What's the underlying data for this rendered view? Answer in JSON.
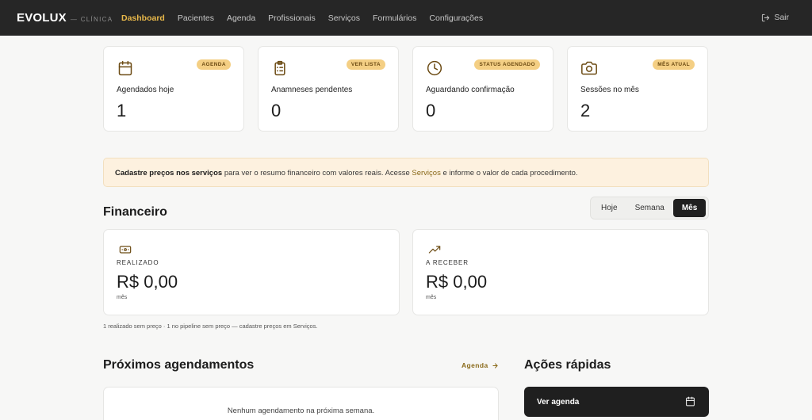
{
  "brand": {
    "name": "EVOLUX",
    "sub": "— CLÍNICA"
  },
  "nav": {
    "items": [
      {
        "label": "Dashboard"
      },
      {
        "label": "Pacientes"
      },
      {
        "label": "Agenda"
      },
      {
        "label": "Profissionais"
      },
      {
        "label": "Serviços"
      },
      {
        "label": "Formulários"
      },
      {
        "label": "Configurações"
      }
    ],
    "active": "Dashboard",
    "logout": "Sair"
  },
  "stats": [
    {
      "icon": "calendar-icon",
      "badge": "AGENDA",
      "label": "Agendados hoje",
      "value": "1"
    },
    {
      "icon": "clipboard-list-icon",
      "badge": "VER LISTA",
      "label": "Anamneses pendentes",
      "value": "0"
    },
    {
      "icon": "clock-icon",
      "badge": "STATUS AGENDADO",
      "label": "Aguardando confirmação",
      "value": "0"
    },
    {
      "icon": "camera-icon",
      "badge": "MÊS ATUAL",
      "label": "Sessões no mês",
      "value": "2"
    }
  ],
  "notice": {
    "bold": "Cadastre preços nos serviços",
    "text1": " para ver o resumo financeiro com valores reais. Acesse ",
    "link": "Serviços",
    "text2": " e informe o valor de cada procedimento."
  },
  "financeiro": {
    "title": "Financeiro",
    "periods": [
      "Hoje",
      "Semana",
      "Mês"
    ],
    "active_period": "Mês",
    "cards": [
      {
        "icon": "banknote-icon",
        "label": "REALIZADO",
        "value": "R$ 0,00",
        "sub": "mês"
      },
      {
        "icon": "trending-up-icon",
        "label": "A RECEBER",
        "value": "R$ 0,00",
        "sub": "mês"
      }
    ],
    "note": "1 realizado sem preço · 1 no pipeline sem preço — cadastre preços em Serviços."
  },
  "proximos": {
    "title": "Próximos agendamentos",
    "link": "Agenda",
    "empty": "Nenhum agendamento na próxima semana."
  },
  "acoes": {
    "title": "Ações rápidas",
    "buttons": [
      {
        "label": "Ver agenda",
        "icon": "calendar-icon"
      }
    ]
  },
  "colors": {
    "accent": "#e8b84a",
    "topbar": "#262626",
    "badge": "#f4cf84",
    "notice_bg": "#fdf1df"
  }
}
